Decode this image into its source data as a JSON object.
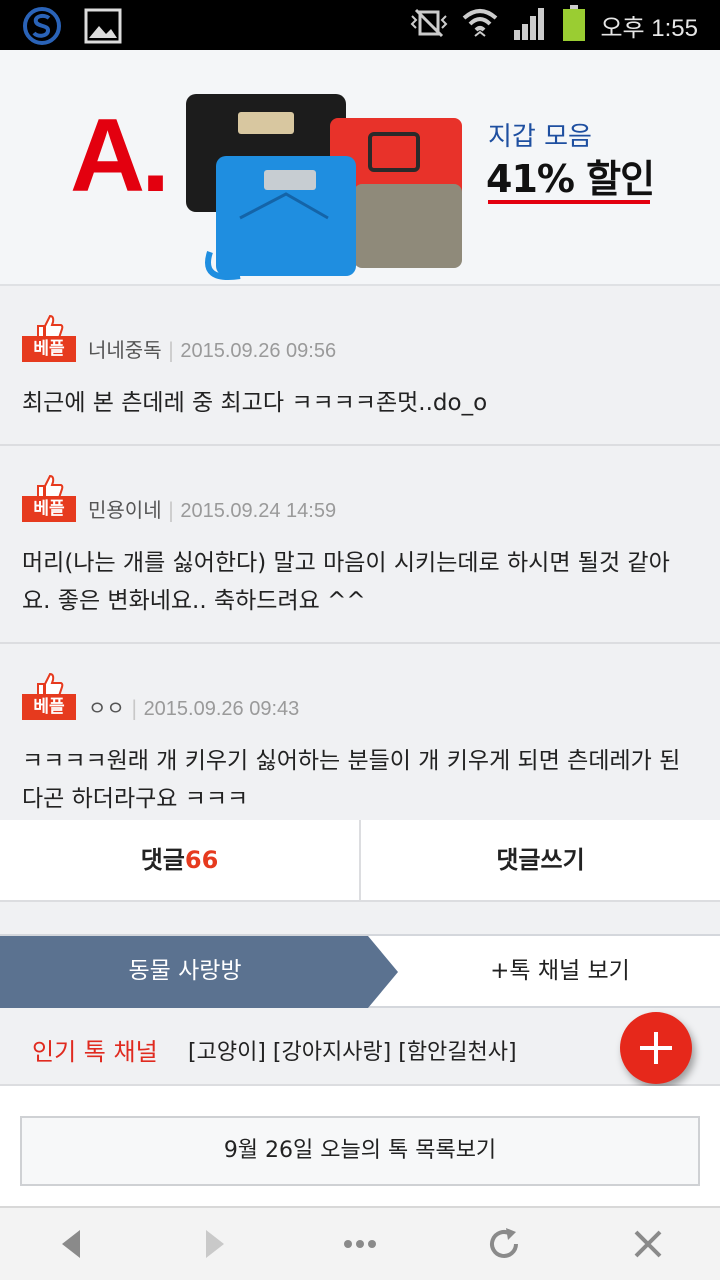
{
  "status_bar": {
    "time": "오후 1:55",
    "icons": [
      "app-logo-icon",
      "image-icon",
      "vibrate-icon",
      "wifi-icon",
      "signal-icon",
      "battery-icon"
    ]
  },
  "banner": {
    "logo_text": "A.",
    "subtitle": "지갑 모음",
    "headline": "41% 할인"
  },
  "comments": [
    {
      "badge": "베플",
      "author": "너네중독",
      "date": "2015.09.26 09:56",
      "text": "최근에 본 츤데레 중 최고다 ㅋㅋㅋㅋ존멋..do_o"
    },
    {
      "badge": "베플",
      "author": "민용이네",
      "date": "2015.09.24 14:59",
      "text": "머리(나는 개를 싫어한다) 말고 마음이 시키는데로 하시면 될것 같아요. 좋은 변화네요.. 축하드려요 ^^"
    },
    {
      "badge": "베플",
      "author": "ㅇㅇ",
      "date": "2015.09.26 09:43",
      "text": "ㅋㅋㅋㅋ원래 개 키우기 싫어하는 분들이 개 키우게 되면 츤데레가 된다곤 하더라구요 ㅋㅋㅋ"
    }
  ],
  "reply_bar": {
    "comments_label": "댓글",
    "comments_count": "66",
    "write_label": "댓글쓰기"
  },
  "channel_bar": {
    "active": "동물 사랑방",
    "other": "+톡 채널 보기"
  },
  "popular": {
    "title": "인기 톡 채널",
    "tags": "[고양이] [강아지사랑] [함안길천사]"
  },
  "list_button": "9월 26일 오늘의 톡 목록보기",
  "nav": {
    "icons": [
      "back-arrow-icon",
      "forward-arrow-icon",
      "more-dots-icon",
      "refresh-icon",
      "close-icon"
    ]
  },
  "colors": {
    "accent_red": "#e63a1e",
    "channel_active_bg": "#5b7290",
    "banner_blue": "#1e4fa0"
  }
}
